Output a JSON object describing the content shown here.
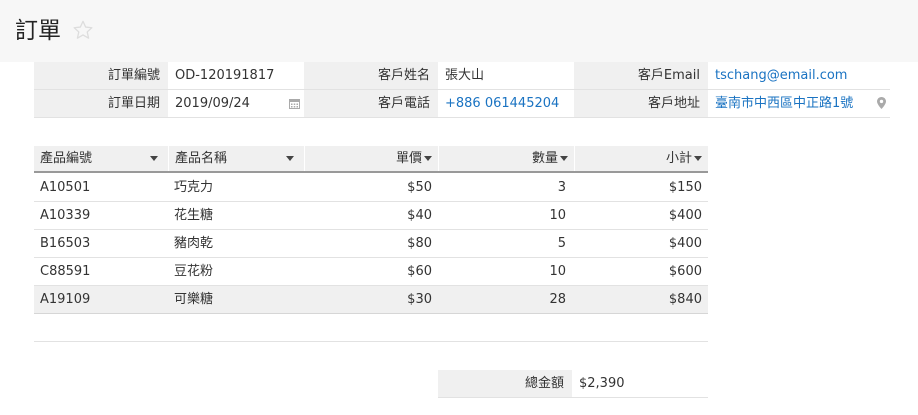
{
  "page": {
    "title": "訂單"
  },
  "order_info": {
    "order_no_label": "訂單編號",
    "order_no": "OD-120191817",
    "order_date_label": "訂單日期",
    "order_date": "2019/09/24",
    "customer_name_label": "客戶姓名",
    "customer_name": "張大山",
    "customer_phone_label": "客戶電話",
    "customer_phone": "+886 061445204",
    "customer_email_label": "客戶Email",
    "customer_email": "tschang@email.com",
    "customer_address_label": "客戶地址",
    "customer_address": "臺南市中西區中正路1號"
  },
  "table": {
    "columns": [
      "產品編號",
      "產品名稱",
      "單價",
      "數量",
      "小計"
    ],
    "rows": [
      [
        "A10501",
        "巧克力",
        "$50",
        "3",
        "$150"
      ],
      [
        "A10339",
        "花生糖",
        "$40",
        "10",
        "$400"
      ],
      [
        "B16503",
        "豬肉乾",
        "$80",
        "5",
        "$400"
      ],
      [
        "C88591",
        "豆花粉",
        "$60",
        "10",
        "$600"
      ],
      [
        "A19109",
        "可樂糖",
        "$30",
        "28",
        "$840"
      ]
    ]
  },
  "total": {
    "label": "總金額",
    "value": "$2,390"
  },
  "icons": {
    "favorite": "star-icon",
    "date": "calendar-icon",
    "address": "map-pin-icon",
    "sort": "caret-down-icon"
  },
  "colors": {
    "link": "#1a73c2",
    "label_bg": "#f0f0f0"
  }
}
